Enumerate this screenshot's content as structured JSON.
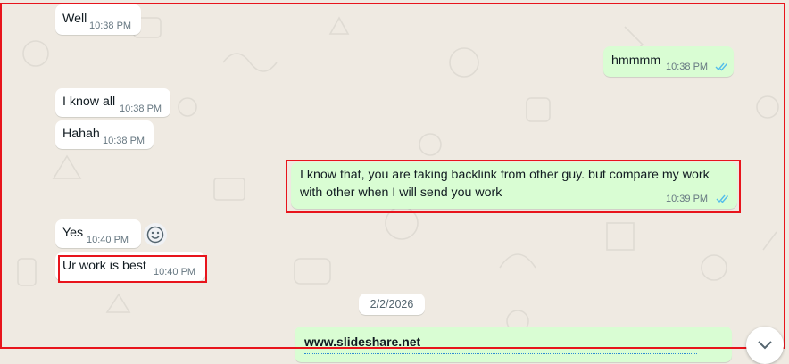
{
  "colors": {
    "background": "#efeae2",
    "incoming_bubble": "#ffffff",
    "outgoing_bubble": "#d9fdd3",
    "read_ticks": "#53bdeb",
    "highlight": "#e8141c"
  },
  "messages": [
    {
      "direction": "incoming",
      "text": "Well",
      "time": "10:38 PM"
    },
    {
      "direction": "outgoing",
      "text": "hmmmm",
      "time": "10:38 PM",
      "status": "read"
    },
    {
      "direction": "incoming",
      "text": "I know all",
      "time": "10:38 PM"
    },
    {
      "direction": "incoming",
      "text": "Hahah",
      "time": "10:38 PM"
    },
    {
      "direction": "outgoing",
      "line1": "I know that, you are taking backlink from other guy. but compare my work",
      "line2": "with  other when I will send you work",
      "time": "10:39 PM",
      "status": "read"
    },
    {
      "direction": "incoming",
      "text": "Yes",
      "time": "10:40 PM"
    },
    {
      "direction": "incoming",
      "text": "Ur work  is best",
      "time": "10:40 PM"
    },
    {
      "direction": "outgoing",
      "link_title": "www.slideshare.net"
    }
  ],
  "date_divider": "2/2/2026",
  "icons": {
    "emoji_reaction": "smiley-icon",
    "read_receipt": "double-check-icon",
    "scroll_down": "chevron-down-icon"
  }
}
